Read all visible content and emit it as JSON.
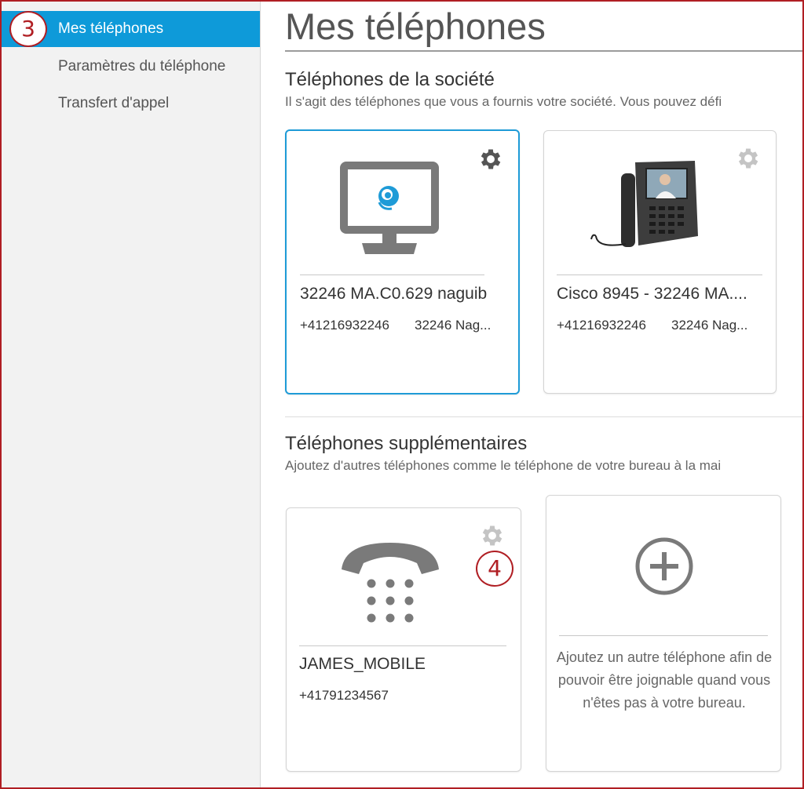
{
  "sidebar": {
    "items": [
      {
        "label": "Mes téléphones",
        "active": true
      },
      {
        "label": "Paramètres du téléphone",
        "active": false
      },
      {
        "label": "Transfert d'appel",
        "active": false
      }
    ]
  },
  "callouts": {
    "step3": "3",
    "step4": "4"
  },
  "page": {
    "title": "Mes téléphones"
  },
  "company_phones": {
    "title": "Téléphones de la société",
    "description": "Il s'agit des téléphones que vous a fournis votre société. Vous pouvez défi",
    "cards": [
      {
        "icon": "computer-softphone-icon",
        "name": "32246 MA.C0.629 naguib",
        "number": "+41216932246",
        "line": "32246 Nag..."
      },
      {
        "icon": "cisco-video-phone-image",
        "name": "Cisco 8945 - 32246 MA....",
        "number": "+41216932246",
        "line": "32246 Nag..."
      }
    ]
  },
  "additional_phones": {
    "title": "Téléphones supplémentaires",
    "description": "Ajoutez d'autres téléphones comme le téléphone de votre bureau à la mai",
    "cards": [
      {
        "icon": "handset-keypad-icon",
        "name": "JAMES_MOBILE",
        "number": "+41791234567"
      }
    ],
    "add_card": {
      "icon": "plus-circle-icon",
      "text": "Ajoutez un autre téléphone afin de pouvoir être joignable quand vous n'êtes pas à votre bureau."
    }
  },
  "colors": {
    "accent": "#0e9ad9",
    "callout": "#b01e23",
    "icon_gray": "#7a7a7a"
  }
}
